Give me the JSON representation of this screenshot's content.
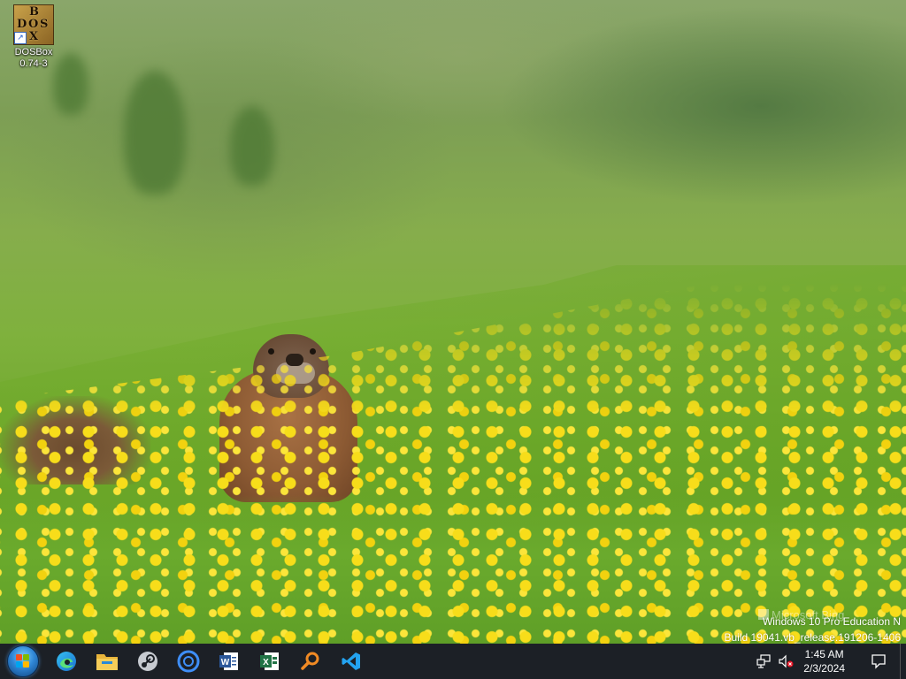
{
  "desktop": {
    "icons": [
      {
        "name": "DOSBox 0.74-3",
        "label": "DOSBox\n0.74-3",
        "icon": "dosbox-icon"
      }
    ]
  },
  "wallpaper": {
    "watermark": "Microsoft Bing"
  },
  "activation": {
    "line1": "Windows 10 Pro Education N",
    "line2": "Build 19041.vb_release.191206-1406"
  },
  "taskbar": {
    "start_button": "start-orb-icon",
    "pinned": [
      {
        "name": "Microsoft Edge",
        "icon": "edge-icon"
      },
      {
        "name": "File Explorer",
        "icon": "folder-icon"
      },
      {
        "name": "Steam",
        "icon": "steam-icon"
      },
      {
        "name": "Google Chrome",
        "icon": "chrome-icon"
      },
      {
        "name": "Microsoft Word",
        "icon": "word-icon"
      },
      {
        "name": "Microsoft Excel",
        "icon": "excel-icon"
      },
      {
        "name": "Search",
        "icon": "magnifier-icon"
      },
      {
        "name": "Visual Studio Code",
        "icon": "vscode-icon"
      }
    ],
    "tray": {
      "network_icon": "network-icon",
      "volume_icon": "volume-muted-icon",
      "time": "1:45 AM",
      "date": "2/3/2024",
      "notification_icon": "notification-icon"
    }
  },
  "colors": {
    "taskbar_bg": "#1c2026",
    "grass": "#6aaa2d",
    "flower": "#f7dd1a"
  }
}
